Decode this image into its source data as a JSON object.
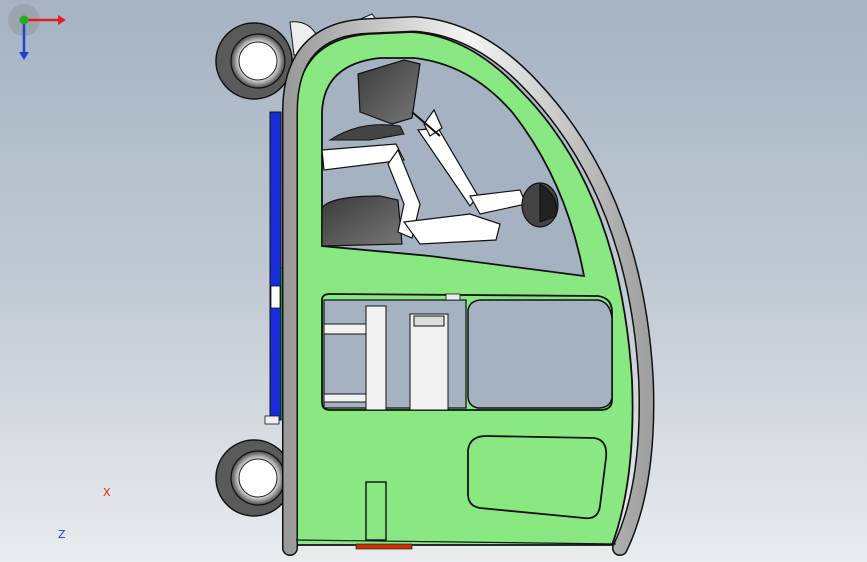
{
  "viewport": {
    "background_top": "#a5b3c3",
    "background_bottom": "#e9ecef"
  },
  "model": {
    "body_color": "#8ae882",
    "frame_color": "#d8d8d8",
    "outline_color": "#111111",
    "seat_color": "#555555",
    "bumper_color": "#1a2bd8",
    "figure_color": "#ffffff"
  },
  "axes": {
    "x_label": "X",
    "z_label": "Z",
    "x_color": "#e02020",
    "y_color": "#20b020",
    "z_color": "#2040d0"
  }
}
